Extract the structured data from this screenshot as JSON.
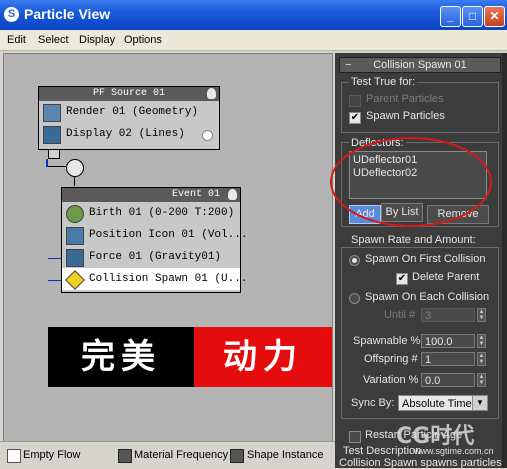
{
  "window": {
    "title": "Particle View",
    "min": "_",
    "max": "□",
    "close": "✕"
  },
  "menu": [
    "Edit",
    "Select",
    "Display",
    "Options"
  ],
  "pf_source": {
    "title": "PF Source 01",
    "ops": [
      {
        "label": "Render 01 (Geometry)",
        "icon": "render-icon"
      },
      {
        "label": "Display 02 (Lines)",
        "icon": "display-icon"
      }
    ]
  },
  "event": {
    "title": "Event 01",
    "ops": [
      {
        "label": "Birth 01 (0-200 T:200)",
        "icon": "birth-icon"
      },
      {
        "label": "Position Icon 01 (Vol...",
        "icon": "position-icon"
      },
      {
        "label": "Force 01 (Gravity01)",
        "icon": "force-icon"
      },
      {
        "label": "Collision Spawn 01 (U...",
        "icon": "collision-spawn-icon"
      }
    ]
  },
  "banner": {
    "left": "完美",
    "right": "动力"
  },
  "panel": {
    "rollout_title": "Collision Spawn 01",
    "rollout_minus": "−",
    "test_true_for": "Test True for:",
    "parent_particles": "Parent Particles",
    "spawn_particles": "Spawn Particles",
    "deflectors_label": "Deflectors:",
    "deflectors": [
      "UDeflector01",
      "UDeflector02"
    ],
    "btn_add": "Add",
    "btn_by_list": "By List",
    "btn_remove": "Remove",
    "spawn_rate_label": "Spawn Rate and Amount:",
    "spawn_first": "Spawn On First Collision",
    "delete_parent": "Delete Parent",
    "spawn_each": "Spawn On Each Collision",
    "until_label": "Until #",
    "until_value": "3",
    "spawnable_label": "Spawnable %",
    "spawnable_value": "100.0",
    "offspring_label": "Offspring #",
    "offspring_value": "1",
    "variation_label": "Variation %",
    "variation_value": "0.0",
    "sync_label": "Sync By:",
    "sync_value": "Absolute Time",
    "restart_label": "Restart Particle Age",
    "test_description": "Test Description",
    "desc_text": "Collision Spawn spawns particles"
  },
  "depot": [
    "Empty Flow",
    "Material Frequency",
    "Shape Instance"
  ],
  "watermark": {
    "text": "CG时代",
    "url": "www.sgtime.com.cn"
  }
}
